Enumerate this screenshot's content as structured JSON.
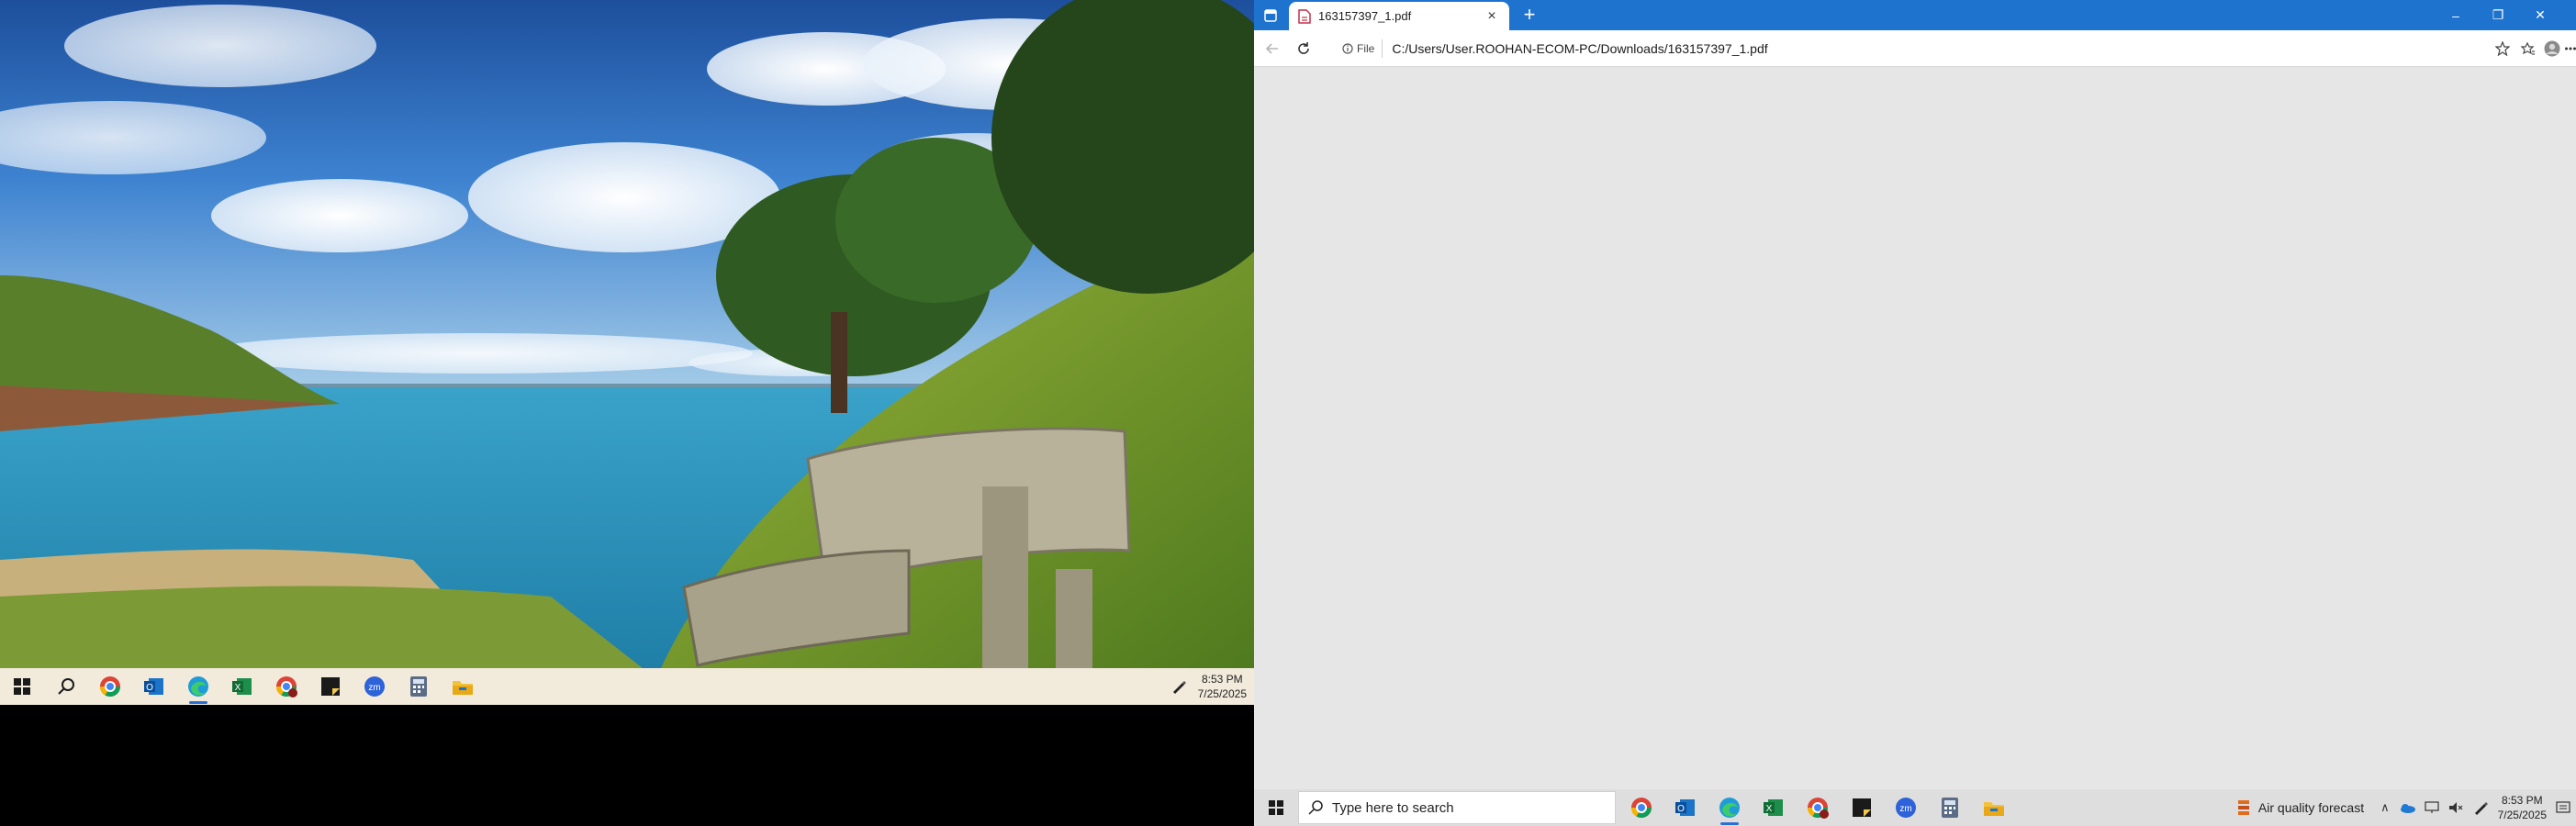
{
  "left_screen": {
    "taskbar": {
      "apps": [
        {
          "name": "windows-start-icon"
        },
        {
          "name": "search-icon"
        },
        {
          "name": "chrome-icon"
        },
        {
          "name": "outlook-icon"
        },
        {
          "name": "edge-icon",
          "active": true
        },
        {
          "name": "excel-icon"
        },
        {
          "name": "chrome-profile-icon"
        },
        {
          "name": "sticky-notes-icon"
        },
        {
          "name": "zoom-icon"
        },
        {
          "name": "calculator-icon"
        },
        {
          "name": "file-explorer-icon"
        }
      ],
      "clock_time": "8:53 PM",
      "clock_date": "7/25/2025"
    }
  },
  "browser": {
    "tab_title": "163157397_1.pdf",
    "new_tab_symbol": "+",
    "file_chip_label": "File",
    "address": "C:/Users/User.ROOHAN-ECOM-PC/Downloads/163157397_1.pdf",
    "close_tab_symbol": "×",
    "window_controls": {
      "minimize": "–",
      "restore": "❐",
      "close": "✕"
    },
    "accent_color": "#1e73cf"
  },
  "right_screen": {
    "taskbar": {
      "search_placeholder": "Type here to search",
      "weather_label": "Air quality forecast",
      "clock_time": "8:53 PM",
      "clock_date": "7/25/2025"
    }
  }
}
